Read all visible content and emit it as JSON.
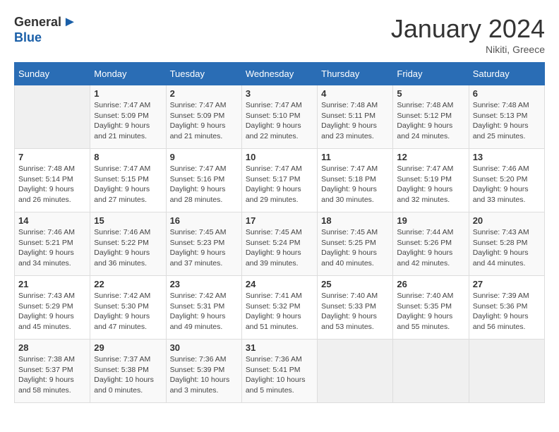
{
  "header": {
    "logo_general": "General",
    "logo_blue": "Blue",
    "month_title": "January 2024",
    "location": "Nikiti, Greece"
  },
  "days_of_week": [
    "Sunday",
    "Monday",
    "Tuesday",
    "Wednesday",
    "Thursday",
    "Friday",
    "Saturday"
  ],
  "weeks": [
    [
      {
        "day": "",
        "sunrise": "",
        "sunset": "",
        "daylight": ""
      },
      {
        "day": "1",
        "sunrise": "Sunrise: 7:47 AM",
        "sunset": "Sunset: 5:09 PM",
        "daylight": "Daylight: 9 hours and 21 minutes."
      },
      {
        "day": "2",
        "sunrise": "Sunrise: 7:47 AM",
        "sunset": "Sunset: 5:09 PM",
        "daylight": "Daylight: 9 hours and 21 minutes."
      },
      {
        "day": "3",
        "sunrise": "Sunrise: 7:47 AM",
        "sunset": "Sunset: 5:10 PM",
        "daylight": "Daylight: 9 hours and 22 minutes."
      },
      {
        "day": "4",
        "sunrise": "Sunrise: 7:48 AM",
        "sunset": "Sunset: 5:11 PM",
        "daylight": "Daylight: 9 hours and 23 minutes."
      },
      {
        "day": "5",
        "sunrise": "Sunrise: 7:48 AM",
        "sunset": "Sunset: 5:12 PM",
        "daylight": "Daylight: 9 hours and 24 minutes."
      },
      {
        "day": "6",
        "sunrise": "Sunrise: 7:48 AM",
        "sunset": "Sunset: 5:13 PM",
        "daylight": "Daylight: 9 hours and 25 minutes."
      }
    ],
    [
      {
        "day": "7",
        "sunrise": "Sunrise: 7:48 AM",
        "sunset": "Sunset: 5:14 PM",
        "daylight": "Daylight: 9 hours and 26 minutes."
      },
      {
        "day": "8",
        "sunrise": "Sunrise: 7:47 AM",
        "sunset": "Sunset: 5:15 PM",
        "daylight": "Daylight: 9 hours and 27 minutes."
      },
      {
        "day": "9",
        "sunrise": "Sunrise: 7:47 AM",
        "sunset": "Sunset: 5:16 PM",
        "daylight": "Daylight: 9 hours and 28 minutes."
      },
      {
        "day": "10",
        "sunrise": "Sunrise: 7:47 AM",
        "sunset": "Sunset: 5:17 PM",
        "daylight": "Daylight: 9 hours and 29 minutes."
      },
      {
        "day": "11",
        "sunrise": "Sunrise: 7:47 AM",
        "sunset": "Sunset: 5:18 PM",
        "daylight": "Daylight: 9 hours and 30 minutes."
      },
      {
        "day": "12",
        "sunrise": "Sunrise: 7:47 AM",
        "sunset": "Sunset: 5:19 PM",
        "daylight": "Daylight: 9 hours and 32 minutes."
      },
      {
        "day": "13",
        "sunrise": "Sunrise: 7:46 AM",
        "sunset": "Sunset: 5:20 PM",
        "daylight": "Daylight: 9 hours and 33 minutes."
      }
    ],
    [
      {
        "day": "14",
        "sunrise": "Sunrise: 7:46 AM",
        "sunset": "Sunset: 5:21 PM",
        "daylight": "Daylight: 9 hours and 34 minutes."
      },
      {
        "day": "15",
        "sunrise": "Sunrise: 7:46 AM",
        "sunset": "Sunset: 5:22 PM",
        "daylight": "Daylight: 9 hours and 36 minutes."
      },
      {
        "day": "16",
        "sunrise": "Sunrise: 7:45 AM",
        "sunset": "Sunset: 5:23 PM",
        "daylight": "Daylight: 9 hours and 37 minutes."
      },
      {
        "day": "17",
        "sunrise": "Sunrise: 7:45 AM",
        "sunset": "Sunset: 5:24 PM",
        "daylight": "Daylight: 9 hours and 39 minutes."
      },
      {
        "day": "18",
        "sunrise": "Sunrise: 7:45 AM",
        "sunset": "Sunset: 5:25 PM",
        "daylight": "Daylight: 9 hours and 40 minutes."
      },
      {
        "day": "19",
        "sunrise": "Sunrise: 7:44 AM",
        "sunset": "Sunset: 5:26 PM",
        "daylight": "Daylight: 9 hours and 42 minutes."
      },
      {
        "day": "20",
        "sunrise": "Sunrise: 7:43 AM",
        "sunset": "Sunset: 5:28 PM",
        "daylight": "Daylight: 9 hours and 44 minutes."
      }
    ],
    [
      {
        "day": "21",
        "sunrise": "Sunrise: 7:43 AM",
        "sunset": "Sunset: 5:29 PM",
        "daylight": "Daylight: 9 hours and 45 minutes."
      },
      {
        "day": "22",
        "sunrise": "Sunrise: 7:42 AM",
        "sunset": "Sunset: 5:30 PM",
        "daylight": "Daylight: 9 hours and 47 minutes."
      },
      {
        "day": "23",
        "sunrise": "Sunrise: 7:42 AM",
        "sunset": "Sunset: 5:31 PM",
        "daylight": "Daylight: 9 hours and 49 minutes."
      },
      {
        "day": "24",
        "sunrise": "Sunrise: 7:41 AM",
        "sunset": "Sunset: 5:32 PM",
        "daylight": "Daylight: 9 hours and 51 minutes."
      },
      {
        "day": "25",
        "sunrise": "Sunrise: 7:40 AM",
        "sunset": "Sunset: 5:33 PM",
        "daylight": "Daylight: 9 hours and 53 minutes."
      },
      {
        "day": "26",
        "sunrise": "Sunrise: 7:40 AM",
        "sunset": "Sunset: 5:35 PM",
        "daylight": "Daylight: 9 hours and 55 minutes."
      },
      {
        "day": "27",
        "sunrise": "Sunrise: 7:39 AM",
        "sunset": "Sunset: 5:36 PM",
        "daylight": "Daylight: 9 hours and 56 minutes."
      }
    ],
    [
      {
        "day": "28",
        "sunrise": "Sunrise: 7:38 AM",
        "sunset": "Sunset: 5:37 PM",
        "daylight": "Daylight: 9 hours and 58 minutes."
      },
      {
        "day": "29",
        "sunrise": "Sunrise: 7:37 AM",
        "sunset": "Sunset: 5:38 PM",
        "daylight": "Daylight: 10 hours and 0 minutes."
      },
      {
        "day": "30",
        "sunrise": "Sunrise: 7:36 AM",
        "sunset": "Sunset: 5:39 PM",
        "daylight": "Daylight: 10 hours and 3 minutes."
      },
      {
        "day": "31",
        "sunrise": "Sunrise: 7:36 AM",
        "sunset": "Sunset: 5:41 PM",
        "daylight": "Daylight: 10 hours and 5 minutes."
      },
      {
        "day": "",
        "sunrise": "",
        "sunset": "",
        "daylight": ""
      },
      {
        "day": "",
        "sunrise": "",
        "sunset": "",
        "daylight": ""
      },
      {
        "day": "",
        "sunrise": "",
        "sunset": "",
        "daylight": ""
      }
    ]
  ]
}
